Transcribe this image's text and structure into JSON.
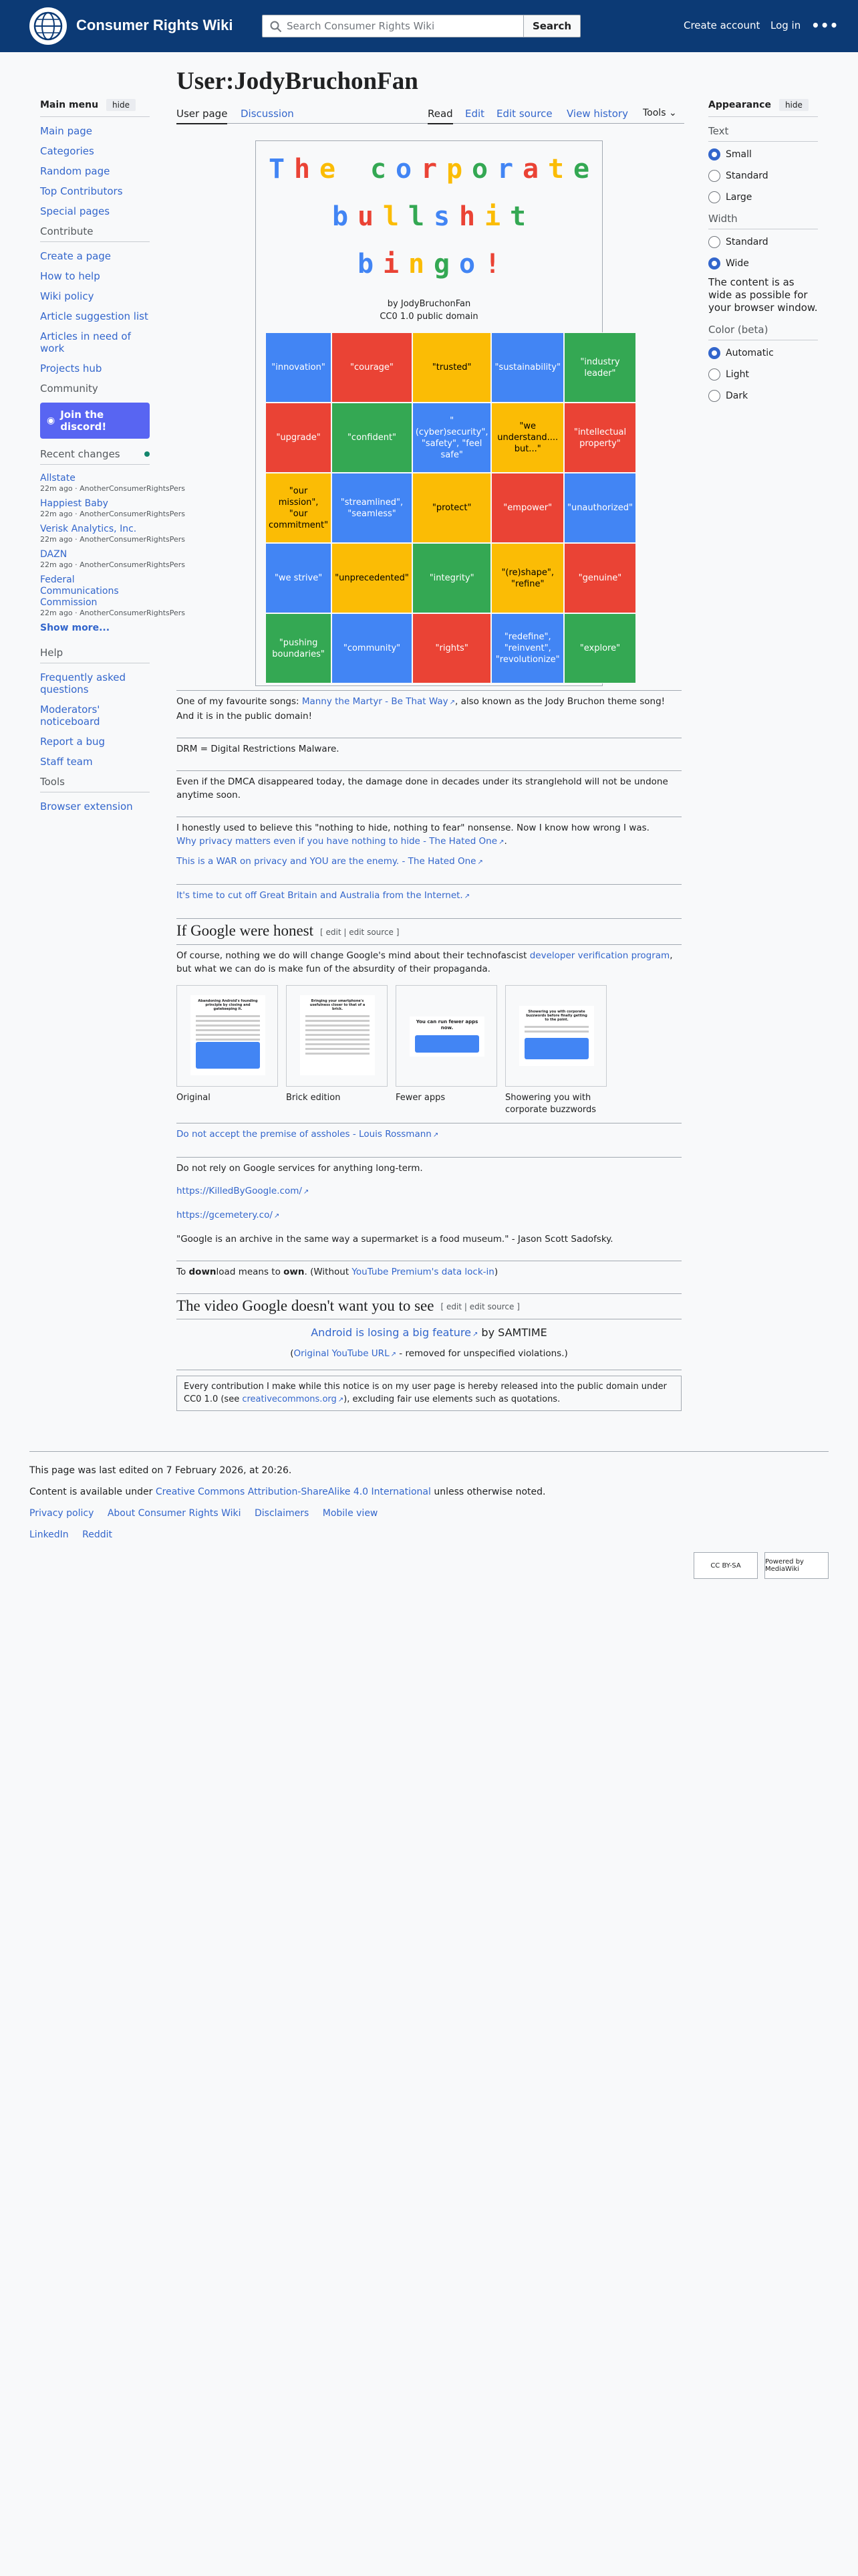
{
  "header": {
    "site_name": "Consumer Rights Wiki",
    "search_placeholder": "Search Consumer Rights Wiki",
    "search_button": "Search",
    "create_account": "Create account",
    "login": "Log in",
    "more": "•••"
  },
  "sidebar": {
    "main_menu": "Main menu",
    "hide": "hide",
    "main_links": [
      "Main page",
      "Categories",
      "Random page",
      "Top Contributors",
      "Special pages"
    ],
    "contribute_title": "Contribute",
    "contribute_links": [
      "Create a page",
      "How to help",
      "Wiki policy",
      "Article suggestion list",
      "Articles in need of work",
      "Projects hub"
    ],
    "community_title": "Community",
    "discord": "Join the discord!",
    "recent_changes_title": "Recent changes",
    "recent_changes": [
      {
        "title": "Allstate",
        "meta": "22m ago · AnotherConsumerRightsPers"
      },
      {
        "title": "Happiest Baby",
        "meta": "22m ago · AnotherConsumerRightsPers"
      },
      {
        "title": "Verisk Analytics, Inc.",
        "meta": "22m ago · AnotherConsumerRightsPers"
      },
      {
        "title": "DAZN",
        "meta": "22m ago · AnotherConsumerRightsPers"
      },
      {
        "title": "Federal Communications Commission",
        "meta": "22m ago · AnotherConsumerRightsPers"
      }
    ],
    "show_more": "Show more...",
    "help_title": "Help",
    "help_links": [
      "Frequently asked questions",
      "Moderators' noticeboard",
      "Report a bug",
      "Staff team"
    ],
    "tools_title": "Tools",
    "tools_links": [
      "Browser extension"
    ]
  },
  "appearance": {
    "title": "Appearance",
    "hide": "hide",
    "text_label": "Text",
    "text_options": [
      "Small",
      "Standard",
      "Large"
    ],
    "width_label": "Width",
    "width_options": [
      "Standard",
      "Wide"
    ],
    "width_note": "The content is as wide as possible for your browser window.",
    "color_label": "Color (beta)",
    "color_options": [
      "Automatic",
      "Light",
      "Dark"
    ]
  },
  "page": {
    "title": "User:JodyBruchonFan",
    "tabs": {
      "user_page": "User page",
      "discussion": "Discussion",
      "read": "Read",
      "edit": "Edit",
      "edit_source": "Edit source",
      "view_history": "View history",
      "tools": "Tools"
    }
  },
  "bingo": {
    "title_line1": [
      "T",
      "h",
      "e",
      " ",
      "c",
      "o",
      "r",
      "p",
      "o",
      "r",
      "a",
      "t",
      "e"
    ],
    "title_line2": [
      "b",
      "u",
      "l",
      "l",
      "s",
      "h",
      "i",
      "t"
    ],
    "title_line3": [
      "b",
      "i",
      "n",
      "g",
      "o",
      "!"
    ],
    "title_colors": [
      "#4285f4",
      "#ea4335",
      "#fbbc05",
      "#34a853"
    ],
    "caption_author": "by JodyBruchonFan",
    "caption_license": "CC0 1.0 public domain",
    "cells": [
      {
        "text": "\"innovation\"",
        "color": "blue"
      },
      {
        "text": "\"courage\"",
        "color": "red"
      },
      {
        "text": "\"trusted\"",
        "color": "yellow"
      },
      {
        "text": "\"sustainability\"",
        "color": "blue"
      },
      {
        "text": "\"industry leader\"",
        "color": "green"
      },
      {
        "text": "\"upgrade\"",
        "color": "red"
      },
      {
        "text": "\"confident\"",
        "color": "green"
      },
      {
        "text": "\"(cyber)security\", \"safety\", \"feel safe\"",
        "color": "blue"
      },
      {
        "text": "\"we understand.... but...\"",
        "color": "yellow"
      },
      {
        "text": "\"intellectual property\"",
        "color": "red"
      },
      {
        "text": "\"our mission\", \"our commitment\"",
        "color": "yellow"
      },
      {
        "text": "\"streamlined\", \"seamless\"",
        "color": "blue"
      },
      {
        "text": "\"protect\"",
        "color": "yellow"
      },
      {
        "text": "\"empower\"",
        "color": "red"
      },
      {
        "text": "\"unauthorized\"",
        "color": "blue"
      },
      {
        "text": "\"we strive\"",
        "color": "blue"
      },
      {
        "text": "\"unprecedented\"",
        "color": "yellow"
      },
      {
        "text": "\"integrity\"",
        "color": "green"
      },
      {
        "text": "\"(re)shape\", \"refine\"",
        "color": "yellow"
      },
      {
        "text": "\"genuine\"",
        "color": "red"
      },
      {
        "text": "\"pushing boundaries\"",
        "color": "green"
      },
      {
        "text": "\"community\"",
        "color": "blue"
      },
      {
        "text": "\"rights\"",
        "color": "red"
      },
      {
        "text": "\"redefine\", \"reinvent\", \"revolutionize\"",
        "color": "blue"
      },
      {
        "text": "\"explore\"",
        "color": "green"
      }
    ]
  },
  "body": {
    "p1_a": "One of my favourite songs: ",
    "p1_link": "Manny the Martyr - Be That Way",
    "p1_b": ", also known as the Jody Bruchon theme song! And it is in the public domain!",
    "p2": "DRM = Digital Restrictions Malware.",
    "p3": "Even if the DMCA disappeared today, the damage done in decades under its stranglehold will not be undone anytime soon.",
    "p4": "I honestly used to believe this \"nothing to hide, nothing to fear\" nonsense. Now I know how wrong I was.",
    "p4_link": "Why privacy matters even if you have nothing to hide - The Hated One",
    "p5_link": "This is a WAR on privacy and YOU are the enemy. - The Hated One",
    "p6_link": "It's time to cut off Great Britain and Australia from the Internet.",
    "h2_google": "If Google were honest",
    "edit_links": "[ edit | edit source ]",
    "p7_a": "Of course, nothing we do will change Google's mind about their technofascist ",
    "p7_link": "developer verification program",
    "p7_b": ", but what we can do is make fun of the absurdity of their propaganda.",
    "gallery": [
      {
        "caption": "Original",
        "headline": "Abandoning Android's founding principle by closing and gatekeeping it."
      },
      {
        "caption": "Brick edition",
        "headline": "Bringing your smartphone's usefulness closer to that of a brick."
      },
      {
        "caption": "Fewer apps",
        "headline": "You can run fewer apps now."
      },
      {
        "caption": "Showering you with corporate buzzwords",
        "headline": "Showering you with corporate buzzwords before finally getting to the point."
      }
    ],
    "p8_link": "Do not accept the premise of assholes - Louis Rossmann",
    "p9": "Do not rely on Google services for anything long-term.",
    "p10_link": "https://KilledByGoogle.com/",
    "p11_link": "https://gcemetery.co/",
    "p12": "\"Google is an archive in the same way a supermarket is a food museum.\" - Jason Scott Sadofsky.",
    "p13_a": "To ",
    "p13_bold1": "down",
    "p13_b": "load means to ",
    "p13_bold2": "own",
    "p13_c": ". (Without ",
    "p13_link": "YouTube Premium's data lock-in",
    "p13_d": ")",
    "h2_video": "The video Google doesn't want you to see",
    "video_link": "Android is losing a big feature",
    "video_by": " by SAMTIME",
    "video_orig_a": "(",
    "video_orig_link": "Original YouTube URL",
    "video_orig_b": " - removed for unspecified violations.)",
    "notice_a": "Every contribution I make while this notice is on my user page is hereby released into the public domain under CC0 1.0 (see ",
    "notice_link": "creativecommons.org",
    "notice_b": "), excluding fair use elements such as quotations."
  },
  "footer": {
    "last_edited": "This page was last edited on 7 February 2026, at 20:26.",
    "license_a": "Content is available under ",
    "license_link": "Creative Commons Attribution-ShareAlike 4.0 International",
    "license_b": " unless otherwise noted.",
    "links": [
      "Privacy policy",
      "About Consumer Rights Wiki",
      "Disclaimers",
      "Mobile view"
    ],
    "social": [
      "LinkedIn",
      "Reddit"
    ],
    "badge_cc": "CC BY-SA",
    "badge_mw": "Powered by MediaWiki"
  }
}
